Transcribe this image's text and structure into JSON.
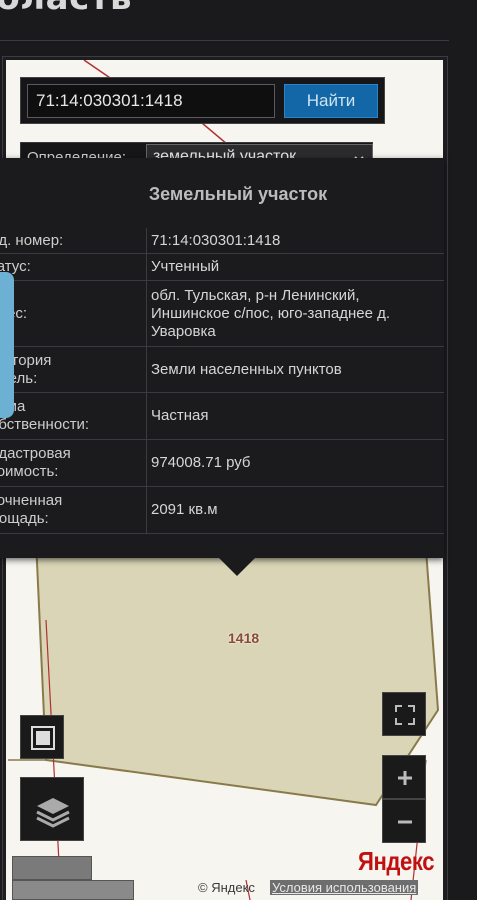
{
  "page": {
    "heading": "бласть"
  },
  "search": {
    "value": "71:14:030301:1418",
    "button_label": "Найти"
  },
  "definition": {
    "label": "Определение:",
    "selected": "земельный участок"
  },
  "popup": {
    "title": "Земельный участок",
    "rows": [
      {
        "key": "ад. номер:",
        "value": "71:14:030301:1418"
      },
      {
        "key": "татус:",
        "value": "Учтенный"
      },
      {
        "key": "дрес:",
        "value": "обл. Тульская, р-н Ленинский, Иншинское с/пос, юго-западнее д. Уваровка"
      },
      {
        "key": "атегория\nемель:",
        "value": "Земли населенных пунктов"
      },
      {
        "key": "орма\nобственности:",
        "value": "Частная"
      },
      {
        "key": "адастровая\nтоимость:",
        "value": "974008.71 руб"
      },
      {
        "key": "точненная\nлощадь:",
        "value": "2091 кв.м"
      }
    ]
  },
  "map": {
    "parcel_label": "1418",
    "copyright": "© Яндекс",
    "terms_link": "Условия использования",
    "logo": "Яндекс",
    "colors": {
      "parcel_fill": "#d9d5b6",
      "parcel_border": "#8a7a4a",
      "boundary_line": "#b03030",
      "accent": "#1367a6"
    }
  },
  "controls": {
    "fullscreen_icon": "fullscreen-icon",
    "zoom_in_icon": "plus-icon",
    "zoom_out_icon": "minus-icon",
    "layers_icon": "layers-icon",
    "ruler_icon": "square-icon"
  }
}
